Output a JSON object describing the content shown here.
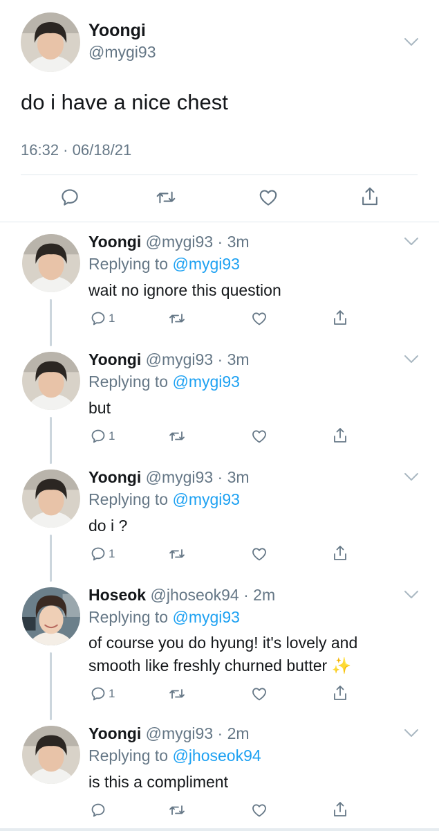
{
  "main_tweet": {
    "name": "Yoongi",
    "handle": "@mygi93",
    "text": "do i have a nice chest",
    "timestamp": "16:32 · 06/18/21"
  },
  "replies": [
    {
      "name": "Yoongi",
      "handle": "@mygi93",
      "time": "3m",
      "replying_label": "Replying to",
      "replying_to": "@mygi93",
      "lines": [
        "wait no ignore this question"
      ],
      "reply_count": "1"
    },
    {
      "name": "Yoongi",
      "handle": "@mygi93",
      "time": "3m",
      "replying_label": "Replying to",
      "replying_to": "@mygi93",
      "lines": [
        "but"
      ],
      "reply_count": "1"
    },
    {
      "name": "Yoongi",
      "handle": "@mygi93",
      "time": "3m",
      "replying_label": "Replying to",
      "replying_to": "@mygi93",
      "lines": [
        "do i ?"
      ],
      "reply_count": "1"
    },
    {
      "name": "Hoseok",
      "handle": "@jhoseok94",
      "time": "2m",
      "replying_label": "Replying to",
      "replying_to": "@mygi93",
      "lines": [
        "of course you do hyung! it's lovely and",
        "smooth like freshly churned butter"
      ],
      "emoji": "✨",
      "reply_count": "1"
    },
    {
      "name": "Yoongi",
      "handle": "@mygi93",
      "time": "2m",
      "replying_label": "Replying to",
      "replying_to": "@jhoseok94",
      "lines": [
        "is this a compliment"
      ],
      "reply_count": ""
    }
  ],
  "icons": {
    "more": "chevron-down-icon",
    "reply": "reply-bubble-icon",
    "retweet": "retweet-icon",
    "like": "heart-icon",
    "share": "share-icon"
  },
  "colors": {
    "link": "#1da1f2",
    "secondary_text": "#657786",
    "divider": "#e1e8ed",
    "thread_line": "#ccd6dd"
  }
}
